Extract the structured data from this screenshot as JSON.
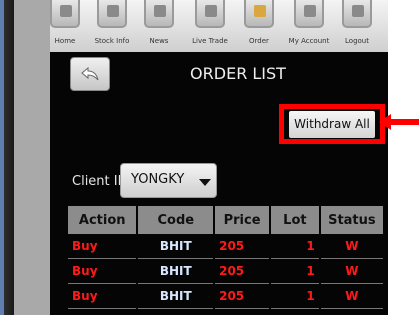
{
  "nav": {
    "items": [
      {
        "label": "Home",
        "icon": "home-icon"
      },
      {
        "label": "Stock Info",
        "icon": "stock-info-icon"
      },
      {
        "label": "News",
        "icon": "news-icon"
      },
      {
        "label": "Live Trade",
        "icon": "live-trade-icon"
      },
      {
        "label": "Order",
        "icon": "order-icon"
      },
      {
        "label": "My Account",
        "icon": "account-icon"
      },
      {
        "label": "Logout",
        "icon": "logout-icon"
      }
    ]
  },
  "page": {
    "title": "ORDER LIST",
    "withdraw_label": "Withdraw All"
  },
  "client": {
    "label": "Client ID",
    "value": "YONGKY"
  },
  "table": {
    "headers": [
      "Action",
      "Code",
      "Price",
      "Lot",
      "Status"
    ],
    "rows": [
      [
        "Buy",
        "BHIT",
        "205",
        "1",
        "W"
      ],
      [
        "Buy",
        "BHIT",
        "205",
        "1",
        "W"
      ],
      [
        "Buy",
        "BHIT",
        "205",
        "1",
        "W"
      ]
    ]
  },
  "colors": {
    "highlight": "#ff0000",
    "buy": "#ff1a1a",
    "code": "#d8e6ff",
    "header_bg": "#8c8c8c"
  }
}
